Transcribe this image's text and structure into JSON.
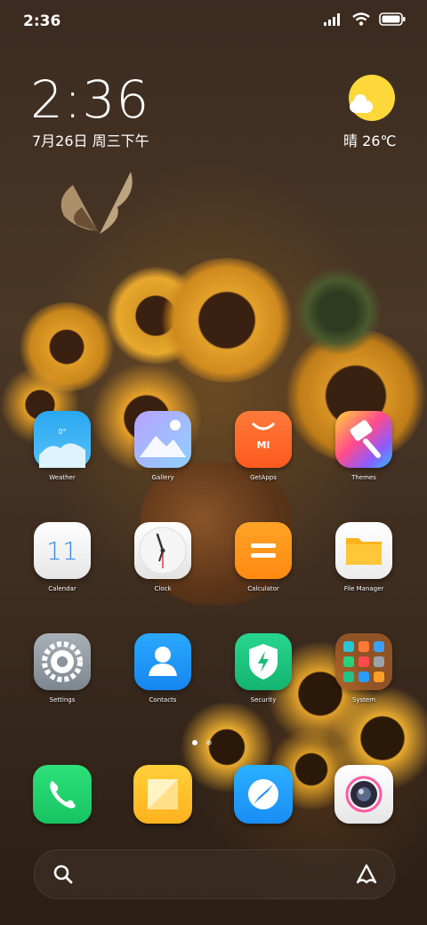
{
  "status_bar": {
    "time": "2:36",
    "icons": [
      "signal-icon",
      "wifi-icon",
      "battery-icon"
    ]
  },
  "clock_widget": {
    "time": "2:36",
    "date": "7月26日 周三下午"
  },
  "weather_widget": {
    "condition_temp": "晴 26℃",
    "icon": "sunny-cloud-icon"
  },
  "apps": [
    {
      "label": "Weather",
      "icon": "weather-icon"
    },
    {
      "label": "Gallery",
      "icon": "gallery-icon"
    },
    {
      "label": "GetApps",
      "icon": "getapps-icon"
    },
    {
      "label": "Themes",
      "icon": "themes-icon"
    },
    {
      "label": "Calendar",
      "icon": "calendar-icon",
      "day": "11"
    },
    {
      "label": "Clock",
      "icon": "clock-icon"
    },
    {
      "label": "Calculator",
      "icon": "calculator-icon"
    },
    {
      "label": "File Manager",
      "icon": "file-manager-icon"
    },
    {
      "label": "Settings",
      "icon": "settings-icon"
    },
    {
      "label": "Contacts",
      "icon": "contacts-icon"
    },
    {
      "label": "Security",
      "icon": "security-icon"
    },
    {
      "label": "System",
      "icon": "system-folder-icon"
    }
  ],
  "weather_icon_text": "0°",
  "getapps_icon_text": "MI",
  "dock": [
    {
      "icon": "phone-icon"
    },
    {
      "icon": "notes-icon"
    },
    {
      "icon": "browser-icon"
    },
    {
      "icon": "camera-icon"
    }
  ],
  "page_indicator": {
    "pages": 2,
    "current": 1
  },
  "search_bar": {
    "left_icon": "search-icon",
    "right_icon": "assistant-icon"
  },
  "colors": {
    "accent_yellow": "#fcd83b",
    "background": "#3b2b20"
  }
}
